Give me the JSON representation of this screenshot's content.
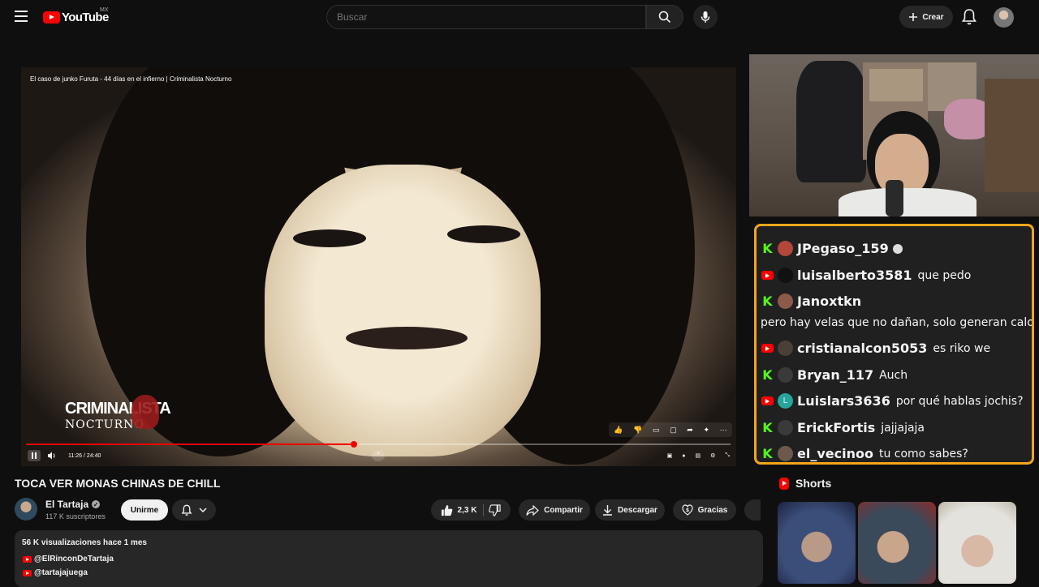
{
  "header": {
    "logo_text": "YouTube",
    "region": "MX",
    "search_placeholder": "Buscar",
    "create_label": "Crear"
  },
  "player": {
    "overlay_title": "El caso de junko Furuta - 44 días en el infierno | Criminalista Nocturno",
    "brand_line1": "CRIMINALISTA",
    "brand_line2": "NOCTURNO",
    "time": "11:26 / 24:40",
    "progress": 0.465,
    "buffered": 0.52
  },
  "chat": {
    "messages": [
      {
        "platform": "kick",
        "user": "JPegaso_159",
        "text": "",
        "avatar_color": "#b3473a"
      },
      {
        "platform": "youtube",
        "user": "luisalberto3581",
        "text": "que pedo",
        "avatar_color": "#111111"
      },
      {
        "platform": "kick",
        "user": "Janoxtkn",
        "text": "",
        "avatar_color": "#8b5a4a"
      },
      {
        "platform": "none",
        "user": "",
        "text": "pero hay velas que no dañan, solo generan calor",
        "avatar_color": ""
      },
      {
        "platform": "youtube",
        "user": "cristianalcon5053",
        "text": "es riko we",
        "avatar_color": "#4a4038"
      },
      {
        "platform": "kick",
        "user": "Bryan_117",
        "text": "Auch",
        "avatar_color": "#3a3a3a"
      },
      {
        "platform": "youtube",
        "user": "Luislars3636",
        "text": "por qué hablas jochis?",
        "avatar_color": "#26a69a",
        "avatar_letter": "L"
      },
      {
        "platform": "kick",
        "user": "ErickFortis",
        "text": "jajjajaja",
        "avatar_color": "#3a3a3a"
      },
      {
        "platform": "kick",
        "user": "el_vecinoo",
        "text": "tu como sabes?",
        "avatar_color": "#6b5a4a"
      }
    ]
  },
  "video": {
    "title": "TOCA VER MONAS CHINAS DE CHILL",
    "channel_name": "El Tartaja",
    "subscribers": "117 K suscriptores",
    "join_label": "Unirme",
    "likes": "2,3 K",
    "share_label": "Compartir",
    "download_label": "Descargar",
    "thanks_label": "Gracias",
    "views_line": "56 K visualizaciones  hace 1 mes",
    "tags": [
      "@ElRinconDeTartaja",
      "@tartajajuega"
    ]
  },
  "shorts": {
    "label": "Shorts"
  },
  "colors": {
    "accent_red": "#ff0000",
    "chat_border": "#f3a51a",
    "kick_green": "#53fc18"
  }
}
